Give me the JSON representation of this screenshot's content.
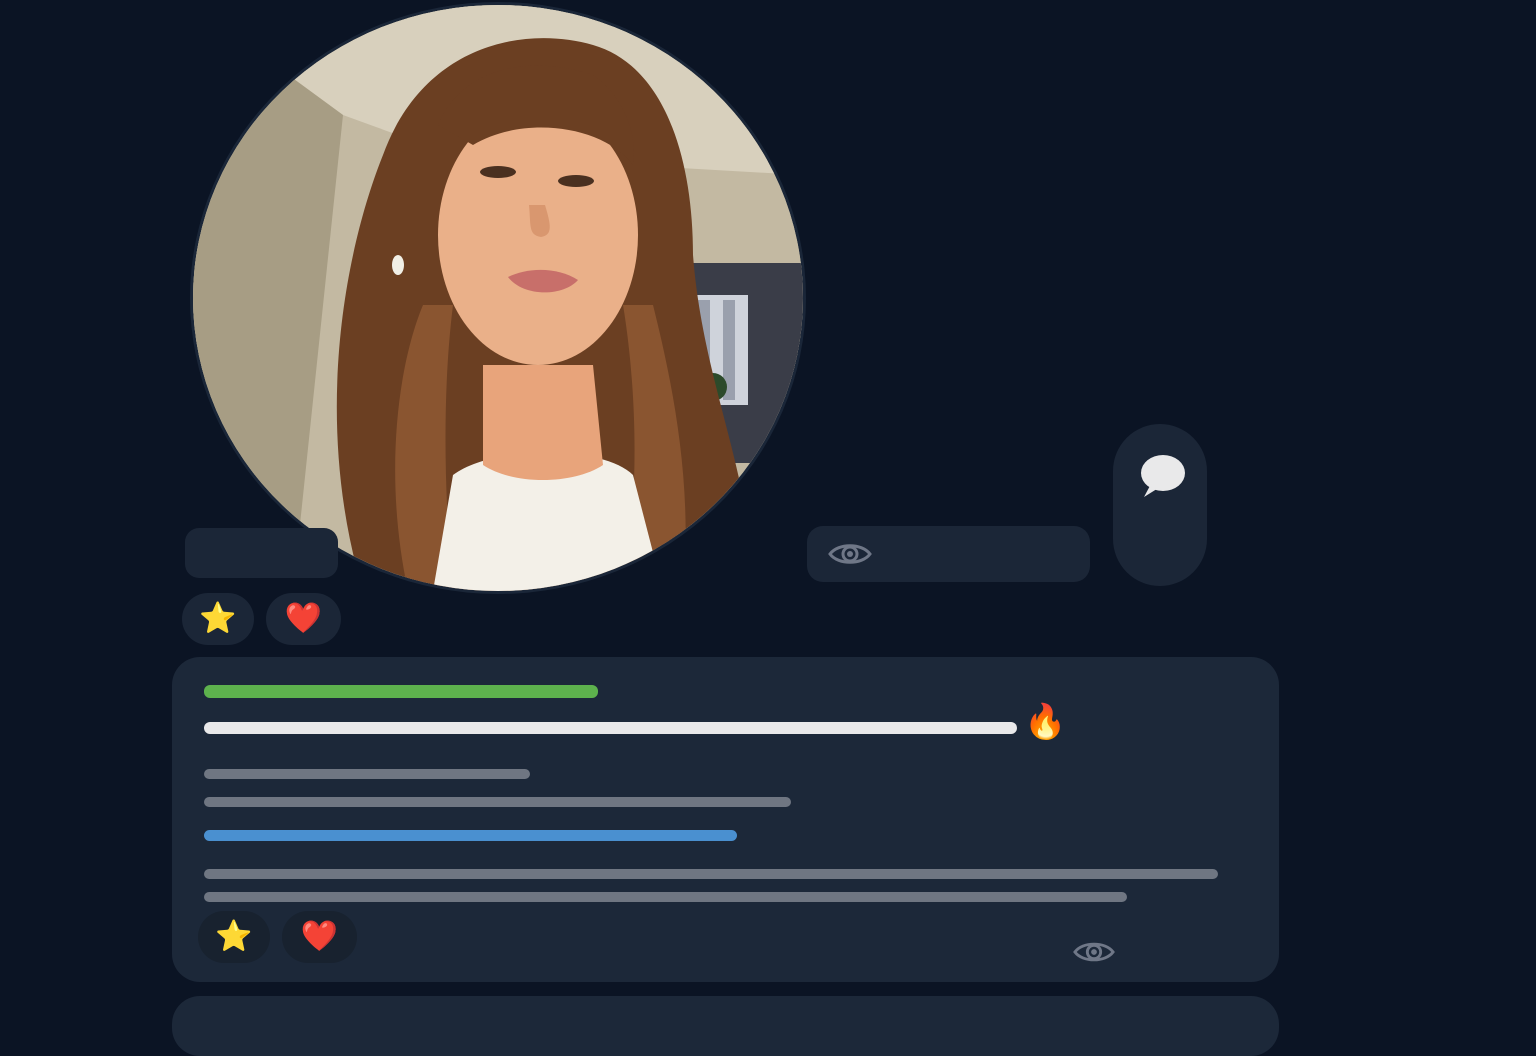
{
  "profile": {
    "avatar_icon": "profile-photo",
    "name_placeholder_label": "",
    "views_label": "",
    "actions": {
      "message_icon": "speech-bubble-icon",
      "views_icon": "eye-icon"
    }
  },
  "reactions_top": [
    {
      "icon": "star-icon",
      "glyph": "⭐"
    },
    {
      "icon": "heart-icon",
      "glyph": "❤️"
    }
  ],
  "post_card": {
    "trending_glyph": "🔥",
    "reactions": [
      {
        "icon": "star-icon",
        "glyph": "⭐"
      },
      {
        "icon": "heart-icon",
        "glyph": "❤️"
      }
    ],
    "view_icon": "eye-icon"
  },
  "colors": {
    "background": "#0b1424",
    "card": "#1c2839",
    "accent_green": "#5db24d",
    "accent_blue": "#4a90d0",
    "text_placeholder": "#6f7682",
    "title_placeholder": "#e9e9ea"
  }
}
